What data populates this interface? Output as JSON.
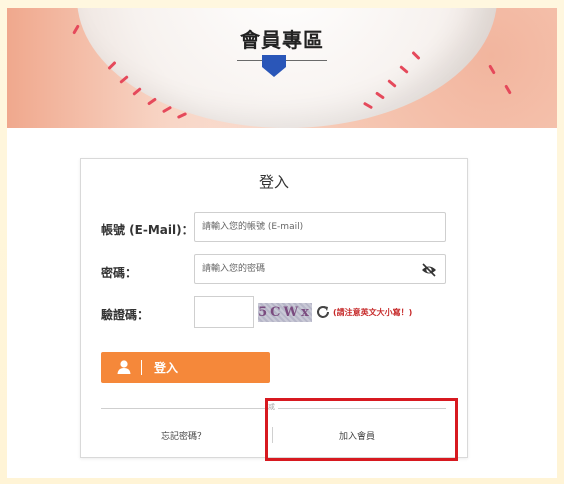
{
  "banner": {
    "title": "會員專區"
  },
  "login": {
    "title": "登入",
    "account_label": "帳號 (E-Mail)：",
    "account_placeholder": "請輸入您的帳號 (E-mail)",
    "password_label": "密碼：",
    "password_placeholder": "請輸入您的密碼",
    "captcha_label": "驗證碼：",
    "captcha_image_text": "5CWx",
    "captcha_note": "(請注意英文大小寫！)",
    "login_button": "登入",
    "divider_text": "或",
    "forgot_password": "忘記密碼？",
    "join_member": "加入會員"
  },
  "icons": {
    "user": "user-icon",
    "eye": "eye-slash-icon",
    "refresh": "refresh-icon",
    "marker": "shield-marker-icon"
  },
  "colors": {
    "accent_orange": "#f5883a",
    "marker_blue": "#2a56b8",
    "highlight_red": "#d71920",
    "captcha_note_red": "#c62828"
  }
}
